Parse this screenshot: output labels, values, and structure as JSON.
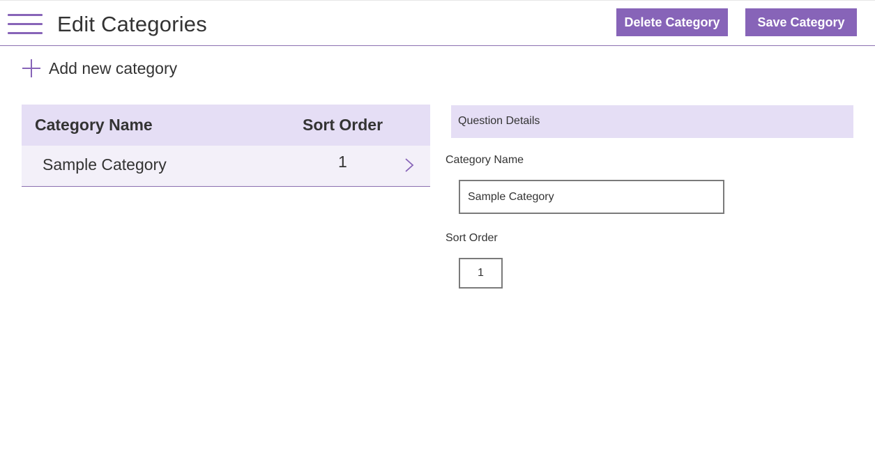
{
  "header": {
    "title": "Edit Categories",
    "delete_label": "Delete Category",
    "save_label": "Save Category"
  },
  "toolbar": {
    "add_new_label": "Add new category"
  },
  "table": {
    "columns": [
      "Category Name",
      "Sort Order"
    ],
    "rows": [
      {
        "name": "Sample Category",
        "sort_order": "1"
      }
    ]
  },
  "details": {
    "title": "Question Details",
    "category_name_label": "Category Name",
    "category_name_value": "Sample Category",
    "sort_order_label": "Sort Order",
    "sort_order_value": "1"
  },
  "colors": {
    "accent": "#8764b8",
    "header_bg": "#e5def5",
    "row_bg": "#f3f0f9"
  }
}
